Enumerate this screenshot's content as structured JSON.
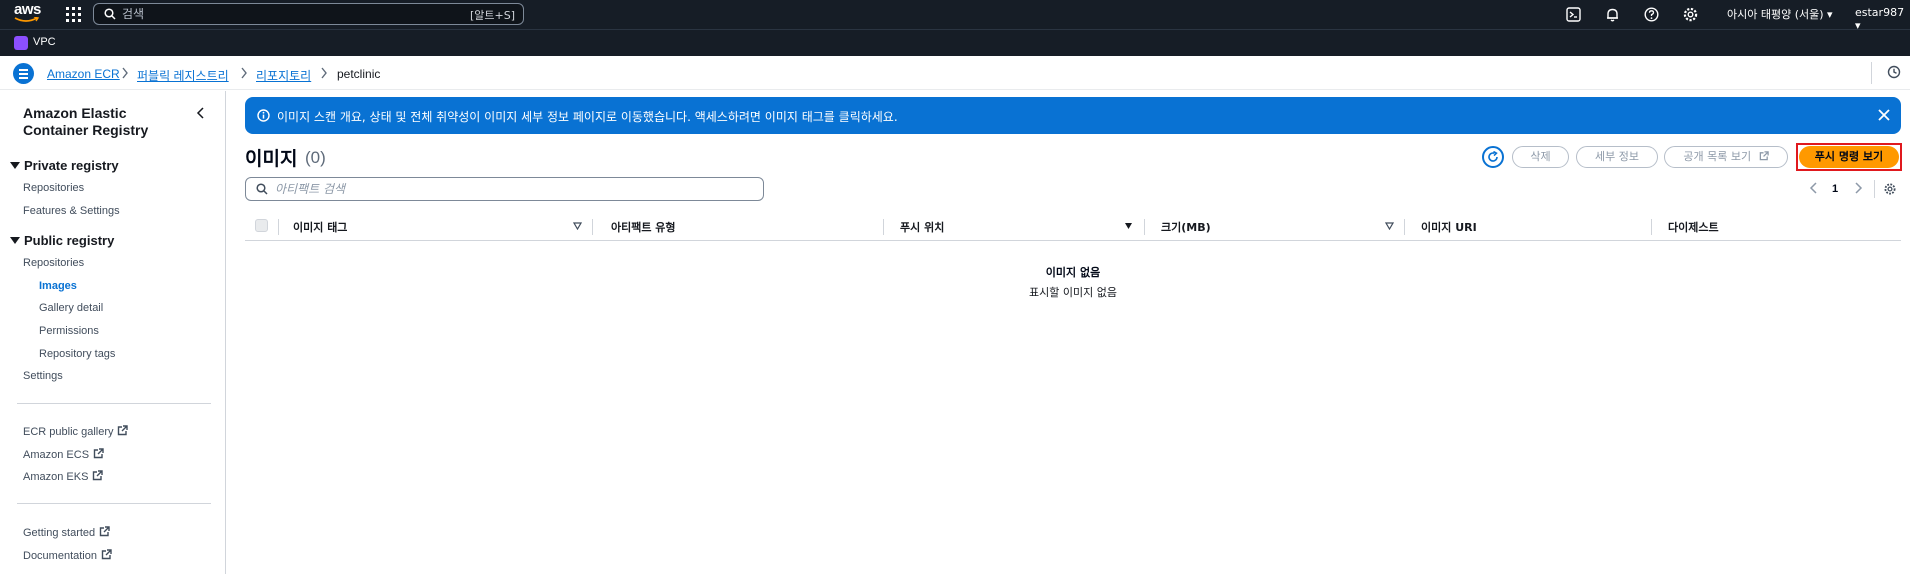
{
  "topbar": {
    "logo_text": "aws",
    "search_placeholder": "검색",
    "search_shortcut": "[알트+S]",
    "region": "아시아 태평양 (서울)",
    "user": "estar987"
  },
  "servicebar": {
    "label": "VPC"
  },
  "breadcrumb": {
    "items": [
      "Amazon ECR",
      "퍼블릭 레지스트리",
      "리포지토리",
      "petclinic"
    ]
  },
  "sidebar": {
    "title": "Amazon Elastic Container Registry",
    "private_section": "Private registry",
    "private_items": [
      "Repositories",
      "Features & Settings"
    ],
    "public_section": "Public registry",
    "public_items": [
      "Repositories",
      "Images",
      "Gallery detail",
      "Permissions",
      "Repository tags",
      "Settings"
    ],
    "external_links": [
      "ECR public gallery",
      "Amazon ECS",
      "Amazon EKS"
    ],
    "help_links": [
      "Getting started",
      "Documentation"
    ]
  },
  "banner": {
    "message": "이미지 스캔 개요, 상태 및 전체 취약성이 이미지 세부 정보 페이지로 이동했습니다. 액세스하려면 이미지 태그를 클릭하세요."
  },
  "header": {
    "title": "이미지",
    "count": "(0)"
  },
  "actions": {
    "delete": "삭제",
    "details": "세부 정보",
    "public_list": "공개 목록 보기",
    "push_commands": "푸시 명령 보기"
  },
  "filter": {
    "placeholder": "아티팩트 검색"
  },
  "pagination": {
    "current_page": "1"
  },
  "table": {
    "columns": [
      "이미지 태그",
      "아티팩트 유형",
      "푸시 위치",
      "크기(MB)",
      "이미지 URI",
      "다이제스트"
    ],
    "empty_title": "이미지 없음",
    "empty_subtitle": "표시할 이미지 없음"
  },
  "colors": {
    "accent": "#0972d3",
    "primary_button": "#ff9900",
    "topbar": "#161d26",
    "highlight_border": "#e0191e"
  }
}
